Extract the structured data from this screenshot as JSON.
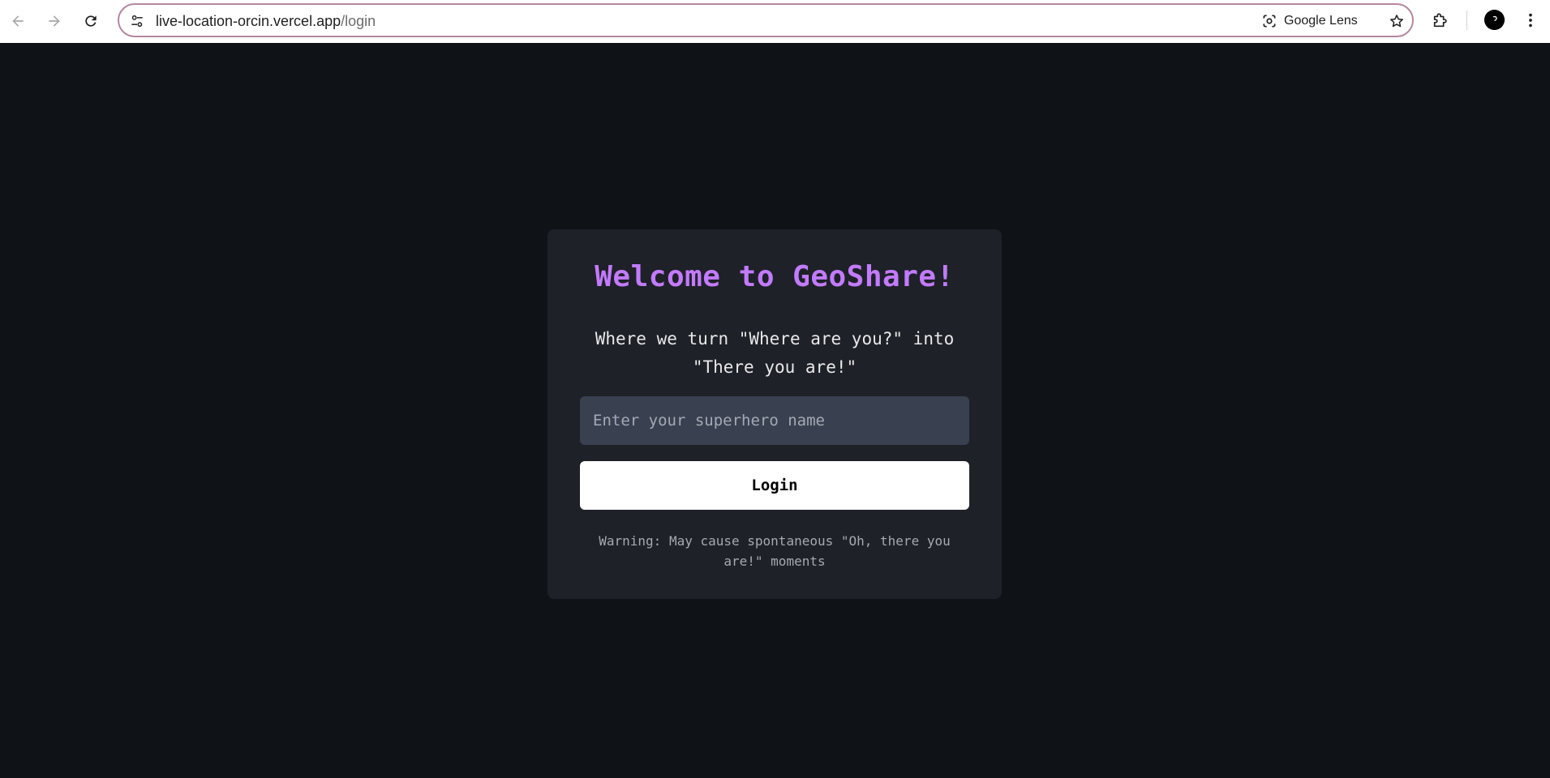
{
  "browser": {
    "url_host": "live-location-orcin.vercel.app",
    "url_path": "/login",
    "lens_label": "Google Lens",
    "icons": {
      "back": "back-arrow-icon",
      "forward": "forward-arrow-icon",
      "reload": "reload-icon",
      "site_info": "tune-icon",
      "lens": "camera-lens-icon",
      "bookmark": "star-icon",
      "extensions": "puzzle-icon",
      "profile": "avatar-icon",
      "menu": "kebab-menu-icon"
    }
  },
  "login": {
    "title": "Welcome to GeoShare!",
    "subtitle_line1": "Where we turn \"Where are you?\" into",
    "subtitle_line2": "\"There you are!\"",
    "name_placeholder": "Enter your superhero name",
    "name_value": "",
    "login_button": "Login",
    "warning_line1": "Warning: May cause spontaneous \"Oh, there you",
    "warning_line2": "are!\" moments"
  },
  "colors": {
    "page_background": "#0f1217",
    "card_background": "#1e2127",
    "title_accent": "#c27aff",
    "input_background": "#394151",
    "button_background": "#ffffff",
    "omnibox_border": "#b4879f"
  }
}
